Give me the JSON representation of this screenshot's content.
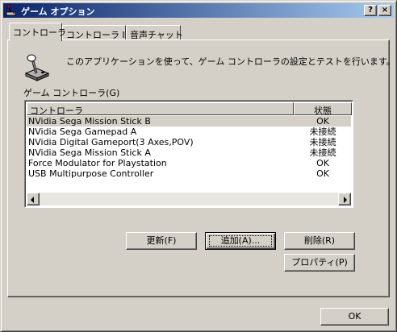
{
  "window": {
    "title": "ゲーム オプション",
    "help_label": "?",
    "close_label": "×"
  },
  "tabs": [
    {
      "label": "コントローラ",
      "active": true
    },
    {
      "label": "コントローラ ID",
      "active": false
    },
    {
      "label": "音声チャット",
      "active": false
    }
  ],
  "panel": {
    "icon": "joystick-icon",
    "description": "このアプリケーションを使って、ゲーム コントローラの設定とテストを行います。",
    "group_label": "ゲーム コントローラ(G)"
  },
  "controllers": {
    "columns": [
      "コントローラ",
      "状態"
    ],
    "rows": [
      {
        "name": "NVidia Sega Mission Stick B",
        "status": "OK",
        "selected": true
      },
      {
        "name": "NVidia Sega Gamepad A",
        "status": "未接続",
        "selected": false
      },
      {
        "name": "NVidia Digital Gameport(3 Axes,POV)",
        "status": "未接続",
        "selected": false
      },
      {
        "name": "NVidia Sega Mission Stick A",
        "status": "未接続",
        "selected": false
      },
      {
        "name": "Force Modulator for Playstation",
        "status": "OK",
        "selected": false
      },
      {
        "name": "USB Multipurpose Controller",
        "status": "OK",
        "selected": false
      }
    ]
  },
  "buttons": {
    "refresh": "更新(F)",
    "add": "追加(A)...",
    "remove": "削除(R)",
    "properties": "プロパティ(P)",
    "ok": "OK"
  },
  "colors": {
    "face": "#d4d0c8",
    "title_start": "#0a246a",
    "title_end": "#a6caf0",
    "list_bg": "#ffffff"
  }
}
